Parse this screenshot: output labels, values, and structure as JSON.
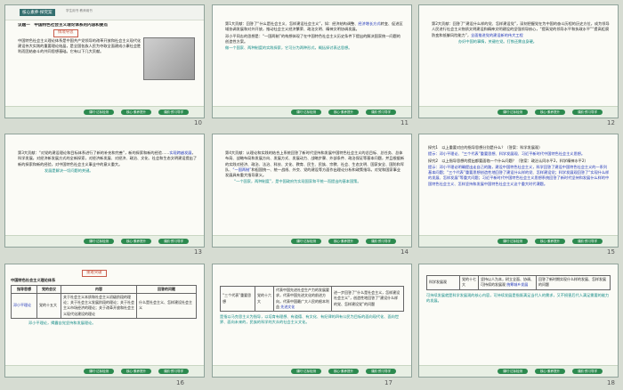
{
  "slides": [
    {
      "num": "10",
      "tab": "核心素养·探究案",
      "sub": "学生用书 教师用书",
      "heading": "议题一　中国特色社会主义理论体系的内容和要点",
      "box": "情境导思",
      "text": "中国特色社会主义理论体系是中国共产党领导的改革开放和社会主义现代化建设伟大实践的重要理论结晶，是全国各族人民为夺取全面建成小康社会胜利而团结奋斗的共同思想基础。它有以下几大贡献。",
      "buttons": [
        "课时·达标检测",
        "核心·素养提升",
        "课前·预习导学"
      ]
    },
    {
      "num": "11",
      "p1": "第1大贡献：回答了“什么是社会主义、怎样建设社会主义”，如：经济结构调整、",
      "p1_link": "经济增长方式",
      "p1_b": "转变、促进区域协调发展和对外开放，推动社会主义经济繁荣、政治文明、精神文明协调发展。",
      "p2": "邓小平同志的思想是：“一国两制”的构想体现了在中国特色社会主义历史条件下提出的解决国家统一问题的创造性方案。",
      "note": "做一个国家、两种制度的实践探索，它可分为两种形式，概括探讨表达思想。",
      "buttons": [
        "课时·达标检测",
        "核心·素养提升",
        "课前·预习导学"
      ]
    },
    {
      "num": "12",
      "p1": "第2大贡献：回答了“建设什么样的党、怎样建设党”，深刻把握党在为中国的奋斗历程的历史方位，成为领导人民进行社会主义物质文明建设和精神文明建设的坚强领导核心，“提高党的领导水平和执政水平”“提高拒腐防变和抵御风险能力”，",
      "p1_link": "全面推进党的建设新的伟大工程",
      "note": "办好中国的事情，关键在党。打铁还需自身硬。",
      "buttons": [
        "课时·达标检测",
        "核心·素养提升",
        "课前·预习导学"
      ]
    },
    {
      "num": "13",
      "p1": "第3大贡献：“对党的建设理论和目标体系进行了新的补充和完善”，新的探索和新的经验……",
      "p1_link": "实现跨越发展",
      "p1_b": "，科学发展，对经济新发展方式的全新探索，对经济新发展、对经济、政治、文化、社会和生态文明建设提出了新的探索和新的经验，对中国特色社会主义事业中的意义重大。",
      "note": "发展是解决一切问题的关键。",
      "buttons": [
        "课时·达标检测",
        "核心·素养提升",
        "课前·预习导学"
      ]
    },
    {
      "num": "14",
      "p1": "第4大贡献：从理论和实践的结合上系统回答了新时代坚持和发展中国特色社会主义的总目标、总任务、总体布局、战略布局和发展方向、发展方式、发展动力、战略步骤、外部条件、政治保证等基本问题，并且根据新的实践对经济、政治、法治、科技、文化、教育、民生、民族、宗教、社会、生态文明、国家安全、国防和军队、",
      "p1_link": "“一国两制”",
      "p1_b": "和祖国统一、统一战线、外交、党的建设等方面作出理论分析和政策指导。对党和国家事业发展具有重大指导意义。",
      "note": "“一个国家，两种制度”，是中国政府为实现国家和平统一而提出的基本国策。",
      "buttons": [
        "课时·达标检测",
        "核心·素养提升",
        "课前·预习导学"
      ]
    },
    {
      "num": "15",
      "q1": "探究1　以上重要对应的指导思想分别是什么？（答案：科学发展观）",
      "a1": "提示：邓小平理论、“三个代表”重要思想、科学发展观、习近平新时代中国特色社会主义思想。",
      "q2": "探究2　以上指导思想的提出都要面临一个什么问题？（答案：政治认同水平2，科学精神水平2）",
      "a2": "提示：邓小平理论明确提出走自己的路，建设中国特色社会主义，科学回答了建设中国特色社会主义的一系列基本问题；“三个代表”重要思想创造性地回答了建设什么样的党、怎样建设党；科学发展观回答了“实现什么样的发展、怎样发展”等重大问题；习近平新时代中国特色社会主义思想系统回答了新时代坚持和发展什么样的中国特色社会主义、怎样坚持和发展中国特色社会主义这个重大时代课题。",
      "buttons": [
        "课时·达标检测",
        "核心·素养提升",
        "课前·预习导学"
      ]
    },
    {
      "num": "16",
      "box": "重难突破",
      "caption": "中国特色社会主义理论体系",
      "headers": [
        "指导思想",
        "党的会议",
        "内容",
        "回答的问题"
      ],
      "row1": [
        "邓小平理论",
        "党的十五大",
        "关于社会主义本质和社会主义初级阶段的理论；关于社会主义发展阶段的理论；关于社会主义市场经济的理论；关于改革开放和社会主义现代化建设的理论",
        "什么是社会主义、怎样建设社会主义"
      ],
      "note": "邓小平理论，揭露自觉坚持和发展理论。",
      "buttons": [
        "课时·达标检测",
        "核心·素养提升",
        "课前·预习导学"
      ]
    },
    {
      "num": "17",
      "row": [
        "“三个代表”重要思想",
        "党的十六大",
        "代表中国先进社会生产力的发展要求，代表中国先进文化的前进方向，代表中国最广大人民的根本利益",
        "进一步回答了“什么是社会主义，怎样建设社会主义”，创造性地回答了“建设什么样的党、怎样建设党”的问题"
      ],
      "row_link": "先进文化",
      "note": "是指以马克思主义为指导，以培育有理想、有道德、有文化、有纪律的四有公民为目标的面向现代化、面向世界、面向未来的，民族的科学的大众的社会主义文化。",
      "buttons": [
        "课时·达标检测",
        "核心·素养提升",
        "课前·预习导学"
      ]
    },
    {
      "num": "18",
      "row": [
        "科学发展观",
        "党的十七大",
        "坚持以人为本，树立全面、协调、可持续的发展观",
        "回答了新时期实现什么样的发展、怎样发展的问题"
      ],
      "row_link": "统筹城乡发展",
      "note": "可持续发展就是科学发展观的核心内容，可持续发展是指既满足当代人的需求，又不损害后代人满足需要的能力的发展。",
      "buttons": [
        "课时·达标检测",
        "核心·素养提升",
        "课前·预习导学"
      ]
    }
  ],
  "colors": {
    "accent": "#1d33b8",
    "teal": "#118a86",
    "button": "#2c8a4f",
    "red": "#c02c2c"
  }
}
